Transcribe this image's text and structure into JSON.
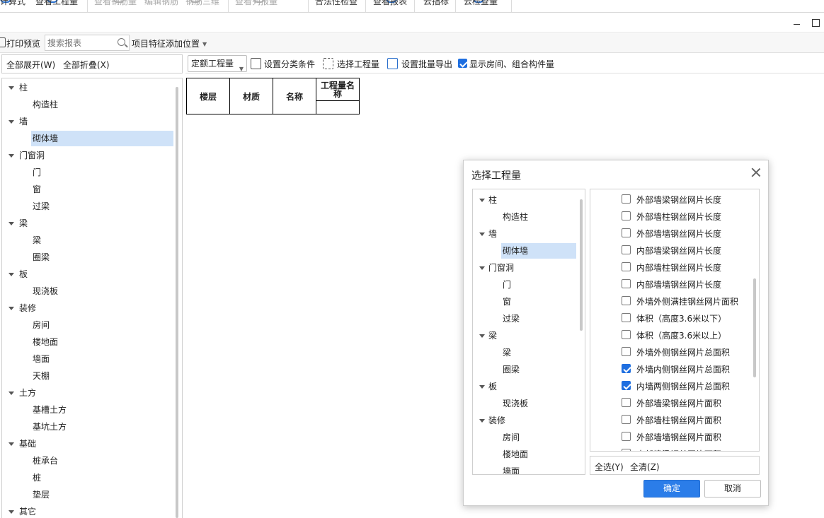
{
  "ribbon": {
    "items": [
      "计算式",
      "查看工程量",
      "查看钢筋量",
      "编辑钢筋",
      "钢筋三维",
      "查看列报量",
      "合法性检查",
      "查看报表",
      "云指标",
      "云检查量"
    ]
  },
  "toolbar": {
    "print_preview": "打印预览",
    "search_placeholder": "搜索报表",
    "add_feature_position": "项目特征添加位置"
  },
  "left_panel": {
    "expand_all": "全部展开(W)",
    "collapse_all": "全部折叠(X)",
    "tree": [
      {
        "label": "柱",
        "level": 0
      },
      {
        "label": "构造柱",
        "level": 1
      },
      {
        "label": "墙",
        "level": 0
      },
      {
        "label": "砌体墙",
        "level": 1,
        "selected": true
      },
      {
        "label": "门窗洞",
        "level": 0
      },
      {
        "label": "门",
        "level": 1
      },
      {
        "label": "窗",
        "level": 1
      },
      {
        "label": "过梁",
        "level": 1
      },
      {
        "label": "梁",
        "level": 0
      },
      {
        "label": "梁",
        "level": 1
      },
      {
        "label": "圈梁",
        "level": 1
      },
      {
        "label": "板",
        "level": 0
      },
      {
        "label": "现浇板",
        "level": 1
      },
      {
        "label": "装修",
        "level": 0
      },
      {
        "label": "房间",
        "level": 1
      },
      {
        "label": "楼地面",
        "level": 1
      },
      {
        "label": "墙面",
        "level": 1
      },
      {
        "label": "天棚",
        "level": 1
      },
      {
        "label": "土方",
        "level": 0
      },
      {
        "label": "基槽土方",
        "level": 1
      },
      {
        "label": "基坑土方",
        "level": 1
      },
      {
        "label": "基础",
        "level": 0
      },
      {
        "label": "桩承台",
        "level": 1
      },
      {
        "label": "桩",
        "level": 1
      },
      {
        "label": "垫层",
        "level": 1
      },
      {
        "label": "其它",
        "level": 0
      }
    ]
  },
  "report_toolbar": {
    "dropdown_value": "定额工程量",
    "set_classification": "设置分类条件",
    "select_quantity": "选择工程量",
    "set_batch_export": "设置批量导出",
    "show_room_label": "显示房间、组合构件量",
    "show_room_checked": true
  },
  "report_table": {
    "headers": [
      "楼层",
      "材质",
      "名称",
      "工程量名称"
    ]
  },
  "dialog": {
    "title": "选择工程量",
    "tree": [
      {
        "label": "柱",
        "level": 0
      },
      {
        "label": "构造柱",
        "level": 1
      },
      {
        "label": "墙",
        "level": 0
      },
      {
        "label": "砌体墙",
        "level": 1,
        "selected": true
      },
      {
        "label": "门窗洞",
        "level": 0
      },
      {
        "label": "门",
        "level": 1
      },
      {
        "label": "窗",
        "level": 1
      },
      {
        "label": "过梁",
        "level": 1
      },
      {
        "label": "梁",
        "level": 0
      },
      {
        "label": "梁",
        "level": 1
      },
      {
        "label": "圈梁",
        "level": 1
      },
      {
        "label": "板",
        "level": 0
      },
      {
        "label": "现浇板",
        "level": 1
      },
      {
        "label": "装修",
        "level": 0
      },
      {
        "label": "房间",
        "level": 1
      },
      {
        "label": "楼地面",
        "level": 1
      },
      {
        "label": "墙面",
        "level": 1
      }
    ],
    "quantities": [
      {
        "label": "外部墙梁钢丝网片长度",
        "checked": false
      },
      {
        "label": "外部墙柱钢丝网片长度",
        "checked": false
      },
      {
        "label": "外部墙墙钢丝网片长度",
        "checked": false
      },
      {
        "label": "内部墙梁钢丝网片长度",
        "checked": false
      },
      {
        "label": "内部墙柱钢丝网片长度",
        "checked": false
      },
      {
        "label": "内部墙墙钢丝网片长度",
        "checked": false
      },
      {
        "label": "外墙外侧满挂钢丝网片面积",
        "checked": false
      },
      {
        "label": "体积（高度3.6米以下）",
        "checked": false
      },
      {
        "label": "体积（高度3.6米以上）",
        "checked": false
      },
      {
        "label": "外墙外侧钢丝网片总面积",
        "checked": false
      },
      {
        "label": "外墙内侧钢丝网片总面积",
        "checked": true
      },
      {
        "label": "内墙两侧钢丝网片总面积",
        "checked": true
      },
      {
        "label": "外部墙梁钢丝网片面积",
        "checked": false
      },
      {
        "label": "外部墙柱钢丝网片面积",
        "checked": false
      },
      {
        "label": "外部墙墙钢丝网片面积",
        "checked": false
      },
      {
        "label": "内部墙梁钢丝网片面积",
        "checked": false
      }
    ],
    "select_all": "全选(Y)",
    "clear_all": "全清(Z)",
    "ok": "确定",
    "cancel": "取消"
  }
}
